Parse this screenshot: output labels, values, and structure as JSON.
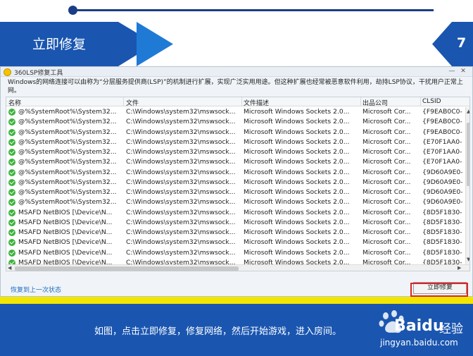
{
  "slide": {
    "title": "立即修复",
    "page_number": "7",
    "caption": "如图，点击立即修复，修复网络，然后开始游戏，进入房间。"
  },
  "window": {
    "title": "360LSP修复工具",
    "description": "Windows的网络连接可以由称为“分层服务提供商(LSP)”的机制进行扩展，实现广泛实用用途。但这种扩展也经常被恶意软件利用，劫持LSP协议，干扰用户正常上网。",
    "controls": {
      "minimize": "—",
      "close": "✕"
    },
    "columns": [
      "名称",
      "文件",
      "文件描述",
      "出品公司",
      "CLSID"
    ],
    "rows": [
      [
        "@%SystemRoot%\\System32...",
        "C:\\Windows\\system32\\mswsock...",
        "Microsoft Windows Sockets 2.0...",
        "Microsoft Cor...",
        "{F9EAB0C0-"
      ],
      [
        "@%SystemRoot%\\System32...",
        "C:\\Windows\\system32\\mswsock...",
        "Microsoft Windows Sockets 2.0...",
        "Microsoft Cor...",
        "{F9EAB0C0-"
      ],
      [
        "@%SystemRoot%\\System32...",
        "C:\\Windows\\system32\\mswsock...",
        "Microsoft Windows Sockets 2.0...",
        "Microsoft Cor...",
        "{F9EAB0C0-"
      ],
      [
        "@%SystemRoot%\\System32...",
        "C:\\Windows\\system32\\mswsock...",
        "Microsoft Windows Sockets 2.0...",
        "Microsoft Cor...",
        "{E70F1AA0-"
      ],
      [
        "@%SystemRoot%\\System32...",
        "C:\\Windows\\system32\\mswsock...",
        "Microsoft Windows Sockets 2.0...",
        "Microsoft Cor...",
        "{E70F1AA0-"
      ],
      [
        "@%SystemRoot%\\System32...",
        "C:\\Windows\\system32\\mswsock...",
        "Microsoft Windows Sockets 2.0...",
        "Microsoft Cor...",
        "{E70F1AA0-"
      ],
      [
        "@%SystemRoot%\\System32...",
        "C:\\Windows\\system32\\mswsock...",
        "Microsoft Windows Sockets 2.0...",
        "Microsoft Cor...",
        "{9D60A9E0-"
      ],
      [
        "@%SystemRoot%\\System32...",
        "C:\\Windows\\system32\\mswsock...",
        "Microsoft Windows Sockets 2.0...",
        "Microsoft Cor...",
        "{9D60A9E0-"
      ],
      [
        "@%SystemRoot%\\System32...",
        "C:\\Windows\\system32\\mswsock...",
        "Microsoft Windows Sockets 2.0...",
        "Microsoft Cor...",
        "{9D60A9E0-"
      ],
      [
        "@%SystemRoot%\\System32...",
        "C:\\Windows\\system32\\mswsock...",
        "Microsoft Windows Sockets 2.0...",
        "Microsoft Cor...",
        "{9D60A9E0-"
      ],
      [
        "MSAFD NetBIOS [\\Device\\N...",
        "C:\\Windows\\system32\\mswsock...",
        "Microsoft Windows Sockets 2.0...",
        "Microsoft Cor...",
        "{8D5F1830-"
      ],
      [
        "MSAFD NetBIOS [\\Device\\N...",
        "C:\\Windows\\system32\\mswsock...",
        "Microsoft Windows Sockets 2.0...",
        "Microsoft Cor...",
        "{8D5F1830-"
      ],
      [
        "MSAFD NetBIOS [\\Device\\N...",
        "C:\\Windows\\system32\\mswsock...",
        "Microsoft Windows Sockets 2.0...",
        "Microsoft Cor...",
        "{8D5F1830-"
      ],
      [
        "MSAFD NetBIOS [\\Device\\N...",
        "C:\\Windows\\system32\\mswsock...",
        "Microsoft Windows Sockets 2.0...",
        "Microsoft Cor...",
        "{8D5F1830-"
      ],
      [
        "MSAFD NetBIOS [\\Device\\N...",
        "C:\\Windows\\system32\\mswsock...",
        "Microsoft Windows Sockets 2.0...",
        "Microsoft Cor...",
        "{8D5F1830-"
      ],
      [
        "MSAFD NetBIOS [\\Device\\N...",
        "C:\\Windows\\system32\\mswsock...",
        "Microsoft Windows Sockets 2.0...",
        "Microsoft Cor...",
        "{8D5F1830-"
      ]
    ],
    "restore_link": "恢复到上一次状态",
    "fix_button": "立即修复"
  },
  "watermark": {
    "brand": "Baidu",
    "suffix": "经验",
    "url": "jingyan.baidu.com"
  },
  "colors": {
    "brand_blue": "#1a56b0",
    "accent_blue": "#1f7ad6",
    "highlight_red": "#e02424",
    "stripe_yellow": "#f2e600",
    "check_green": "#3bb43b"
  },
  "icons": {
    "row_status": "green-check-icon",
    "app_logo": "360-logo-icon"
  }
}
